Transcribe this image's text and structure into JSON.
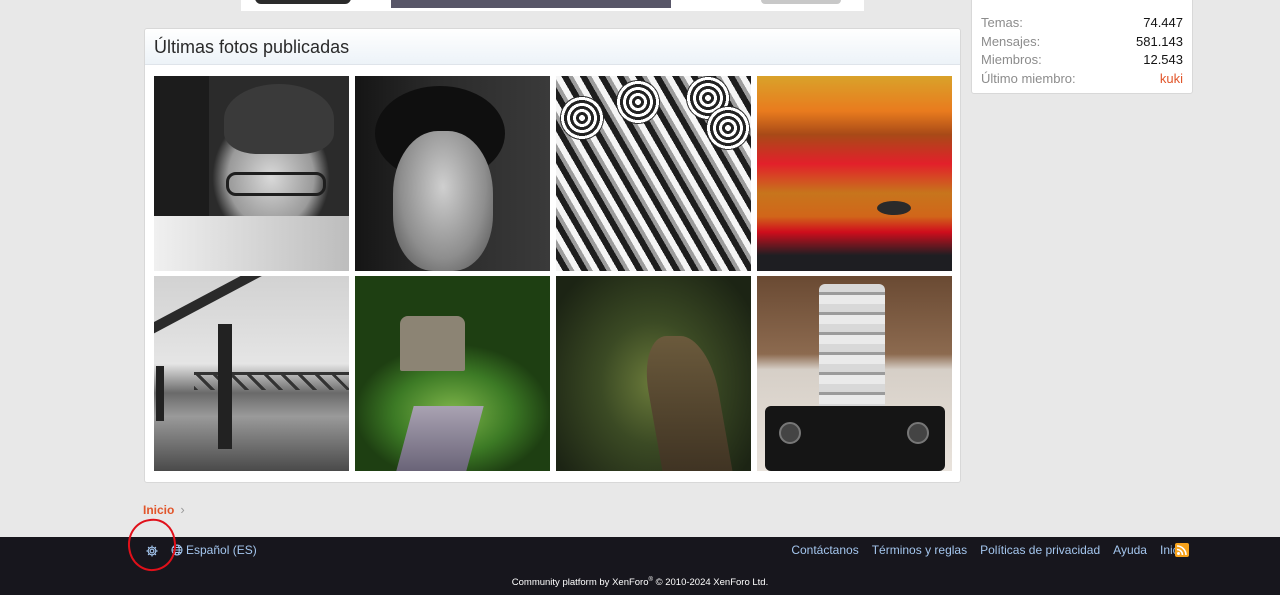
{
  "photos_block": {
    "title": "Últimas fotos publicadas",
    "photos": [
      {
        "name": "photo-bw-man-glasses"
      },
      {
        "name": "photo-bw-woman"
      },
      {
        "name": "photo-bw-festival"
      },
      {
        "name": "photo-fly-on-red"
      },
      {
        "name": "photo-bw-bridge"
      },
      {
        "name": "photo-green-stream"
      },
      {
        "name": "photo-forest-path"
      },
      {
        "name": "photo-camera-lens"
      }
    ]
  },
  "stats": {
    "rows": [
      {
        "label": "Temas:",
        "value": "74.447"
      },
      {
        "label": "Mensajes:",
        "value": "581.143"
      },
      {
        "label": "Miembros:",
        "value": "12.543"
      },
      {
        "label": "Último miembro:",
        "value": "kuki"
      }
    ]
  },
  "breadcrumb": {
    "home": "Inicio",
    "chevron": "›"
  },
  "footer": {
    "gear_icon": "gear-icon",
    "language": "Español (ES)",
    "links": [
      "Contáctanos",
      "Términos y reglas",
      "Políticas de privacidad",
      "Ayuda",
      "Inicio"
    ],
    "rss_icon": "rss-icon",
    "copyright_prefix": "Community platform by XenForo",
    "copyright_mark": "®",
    "copyright_suffix": " © 2010-2024 XenForo Ltd."
  },
  "colors": {
    "accent_link": "#e1552a",
    "footer_bg": "#17161d",
    "footer_link": "#a4c6ee",
    "annotation": "#e0101a"
  }
}
